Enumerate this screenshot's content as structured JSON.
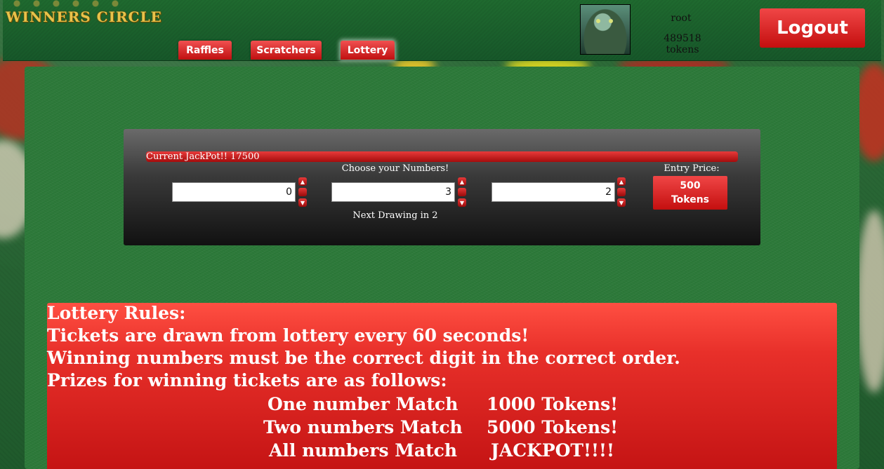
{
  "header": {
    "logo_text": "WINNERS CIRCLE",
    "nav": [
      {
        "label": "Raffles"
      },
      {
        "label": "Scratchers"
      },
      {
        "label": "Lottery",
        "active": true
      }
    ],
    "user": {
      "name": "root",
      "tokens": "489518 tokens"
    },
    "logout_label": "Logout"
  },
  "lottery": {
    "jackpot_text": "Current JackPot!! 17500",
    "choose_label": "Choose your Numbers!",
    "numbers": [
      "0",
      "3",
      "2"
    ],
    "next_drawing": "Next Drawing in 2",
    "entry_price_label": "Entry Price:",
    "entry_amount": "500",
    "entry_unit": "Tokens"
  },
  "rules": {
    "title": "Lottery Rules:",
    "lines": [
      "Tickets are drawn from lottery every 60 seconds!",
      "Winning numbers must be the correct digit in the correct order.",
      "Prizes for winning tickets are as follows:"
    ],
    "prizes": [
      {
        "match": "One number Match",
        "prize": "1000 Tokens!"
      },
      {
        "match": "Two numbers Match",
        "prize": "5000 Tokens!"
      },
      {
        "match": "All numbers Match",
        "prize": "JACKPOT!!!!"
      }
    ]
  },
  "icons": {
    "spin_up": "chevron-up-icon",
    "spin_down": "chevron-down-icon"
  }
}
